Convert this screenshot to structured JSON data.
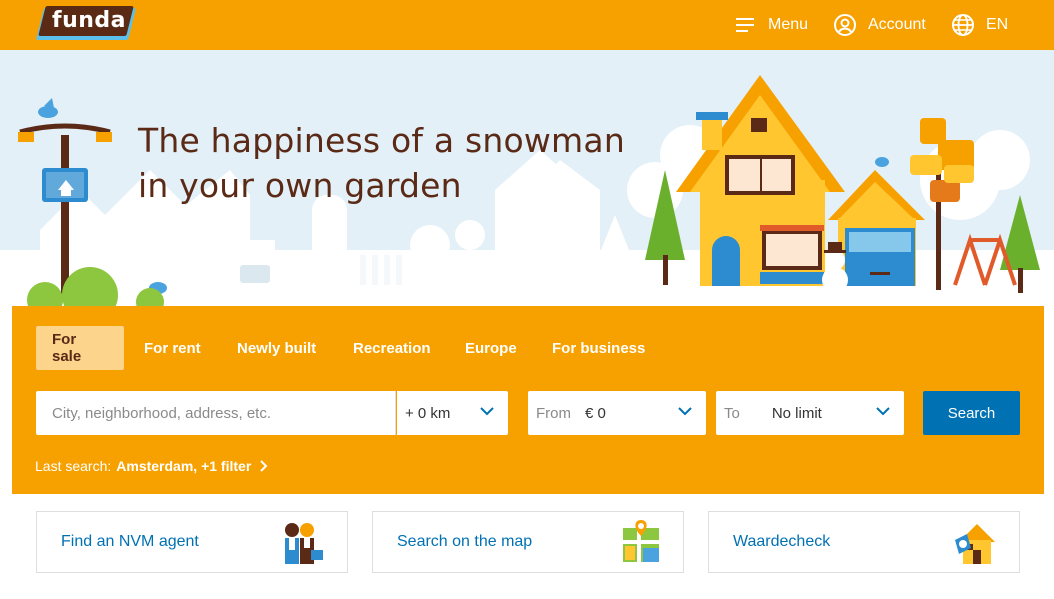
{
  "header": {
    "logo_text": "funda",
    "menu_label": "Menu",
    "account_label": "Account",
    "language_label": "EN",
    "icons": [
      "menu-icon",
      "account-icon",
      "globe-icon"
    ]
  },
  "hero": {
    "headline_line1": "The happiness of a snowman",
    "headline_line2": "in your own garden"
  },
  "search": {
    "tabs": [
      {
        "label": "For sale",
        "active": true
      },
      {
        "label": "For rent",
        "active": false
      },
      {
        "label": "Newly built",
        "active": false
      },
      {
        "label": "Recreation",
        "active": false
      },
      {
        "label": "Europe",
        "active": false
      },
      {
        "label": "For business",
        "active": false
      }
    ],
    "location_placeholder": "City, neighborhood, address, etc.",
    "radius_value": "+ 0 km",
    "price_from_label": "From",
    "price_from_value": "€ 0",
    "price_to_label": "To",
    "price_to_value": "No limit",
    "search_button": "Search",
    "last_search_label": "Last search:",
    "last_search_value": "Amsterdam, +1 filter"
  },
  "cards": [
    {
      "label": "Find an NVM agent",
      "icon": "agents-icon"
    },
    {
      "label": "Search on the map",
      "icon": "map-icon"
    },
    {
      "label": "Waardecheck",
      "icon": "house-value-icon"
    }
  ],
  "colors": {
    "brand_orange": "#F7A100",
    "active_tab": "#FDD48C",
    "button_blue": "#0071B3",
    "headline_brown": "#5a2a16",
    "sky": "#E3F0F8"
  }
}
